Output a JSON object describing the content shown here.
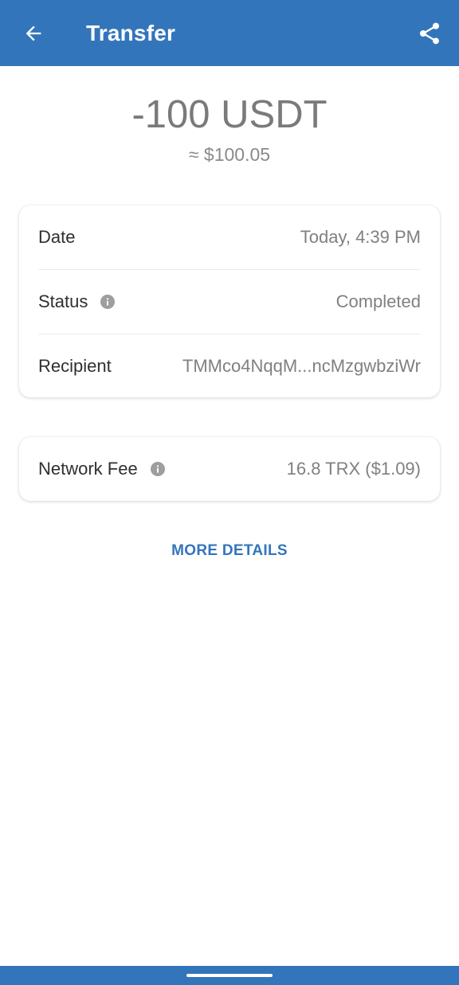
{
  "app_bar": {
    "title": "Transfer",
    "back_icon": "arrow-left-icon",
    "share_icon": "share-icon",
    "color": "#3375bb"
  },
  "summary": {
    "amount": "-100 USDT",
    "fiat_value": "≈ $100.05"
  },
  "details": {
    "rows": [
      {
        "label": "Date",
        "value": "Today, 4:39 PM"
      },
      {
        "label": "Status",
        "value": "Completed",
        "icon": "info-icon"
      },
      {
        "label": "Recipient",
        "value": "TMMco4NqqM...ncMzgwbziWr"
      }
    ]
  },
  "fee": {
    "label": "Network Fee",
    "value": "16.8 TRX ($1.09)",
    "icon": "info-icon"
  },
  "actions": {
    "more_details": "MORE DETAILS"
  }
}
